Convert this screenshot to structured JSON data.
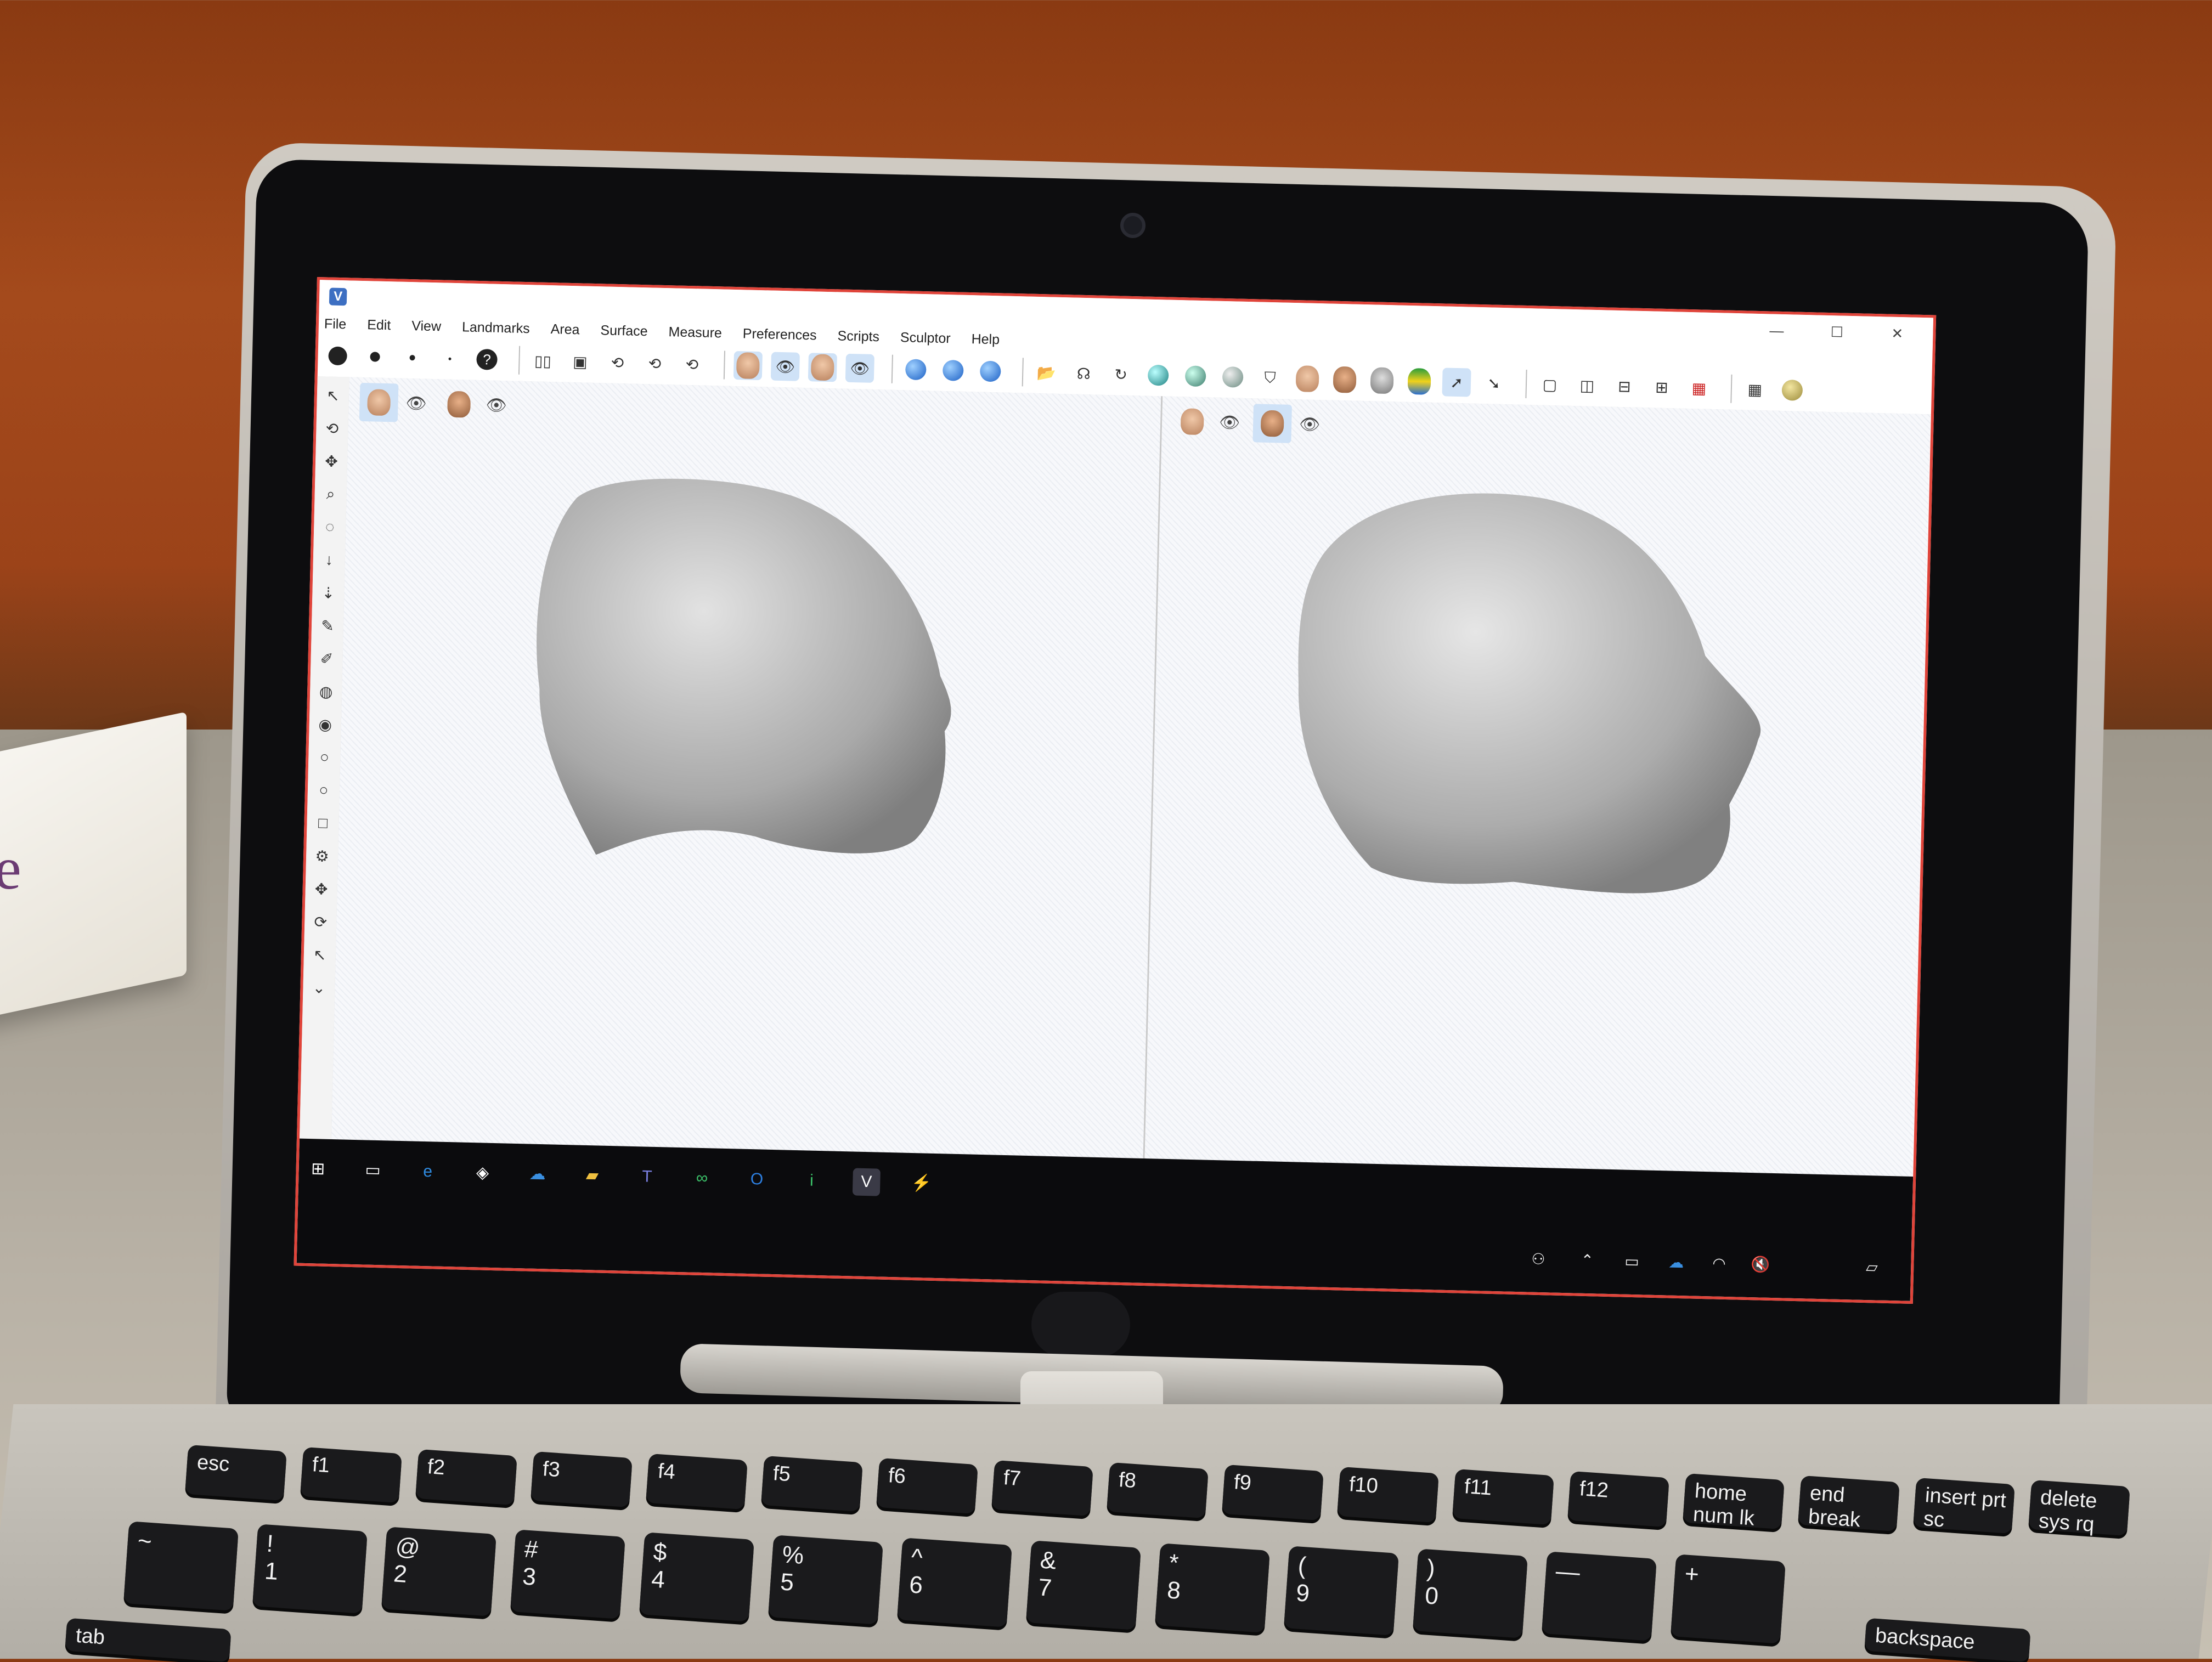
{
  "app": {
    "icon_letter": "V",
    "window_controls": [
      "—",
      "☐",
      "✕"
    ]
  },
  "menu": [
    "File",
    "Edit",
    "View",
    "Landmarks",
    "Area",
    "Surface",
    "Measure",
    "Preferences",
    "Scripts",
    "Sculptor",
    "Help"
  ],
  "toolbar": {
    "help_glyph": "?"
  },
  "viewports": {
    "left": {
      "eye_glyph": "👁"
    },
    "right": {
      "eye_glyph": "👁"
    }
  },
  "taskbar": {
    "apps": [
      "windows-start",
      "task-view",
      "edge",
      "app-generic",
      "onedrive",
      "file-explorer",
      "teams",
      "app-green",
      "outlook",
      "app-i",
      "vectra",
      "acrobat"
    ]
  },
  "keyboard": {
    "row1": [
      "esc",
      "f1",
      "f2",
      "f3",
      "f4",
      "f5",
      "f6",
      "f7",
      "f8",
      "f9",
      "f10",
      "f11",
      "f12",
      "home",
      "end",
      "insert",
      "delete"
    ],
    "row1_sub": [
      "",
      "",
      "",
      "",
      "",
      "",
      "",
      "",
      "",
      "",
      "",
      "",
      "",
      "num lk",
      "break",
      "prt sc",
      "sys rq"
    ],
    "row2": [
      "~",
      "!\n1",
      "@\n2",
      "#\n3",
      "$\n4",
      "%\n5",
      "^\n6",
      "&\n7",
      "*\n8",
      "(\n9",
      ")\n0",
      "—",
      "+"
    ],
    "row3_labels": [
      "tab",
      "backspace"
    ]
  },
  "scene": {
    "card_letter": "e"
  }
}
